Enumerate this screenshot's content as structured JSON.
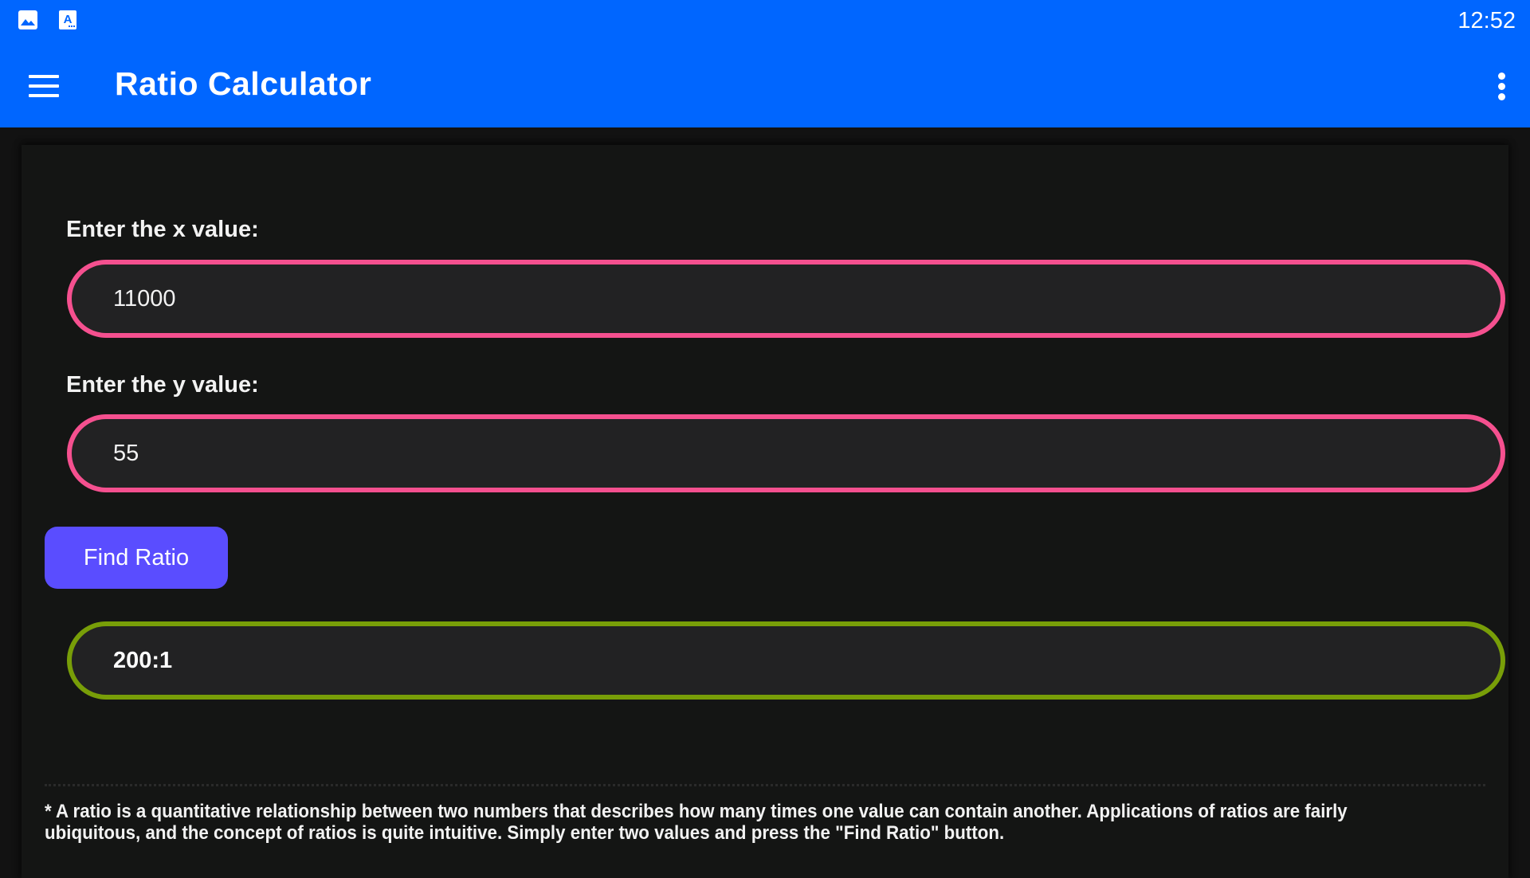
{
  "status_bar": {
    "icons": [
      "image-icon",
      "keyboard-a-icon"
    ],
    "time": "12:52"
  },
  "app_bar": {
    "menu_icon": "hamburger-menu-icon",
    "title": "Ratio Calculator",
    "overflow_icon": "more-vert-icon"
  },
  "form": {
    "x_label": "Enter the x value:",
    "x_value": "11000",
    "y_label": "Enter the y value:",
    "y_value": "55",
    "button_label": "Find Ratio",
    "result": "200:1"
  },
  "footnote": "* A ratio is a quantitative relationship between two numbers that describes how many times one value can contain another. Applications of ratios are fairly ubiquitous, and the concept of ratios is quite intuitive. Simply enter two values and press the \"Find Ratio\" button.",
  "colors": {
    "primary": "#0066FF",
    "input_border": "#F5508F",
    "result_border": "#789E08",
    "button": "#5A4DFF",
    "background": "#121212"
  }
}
